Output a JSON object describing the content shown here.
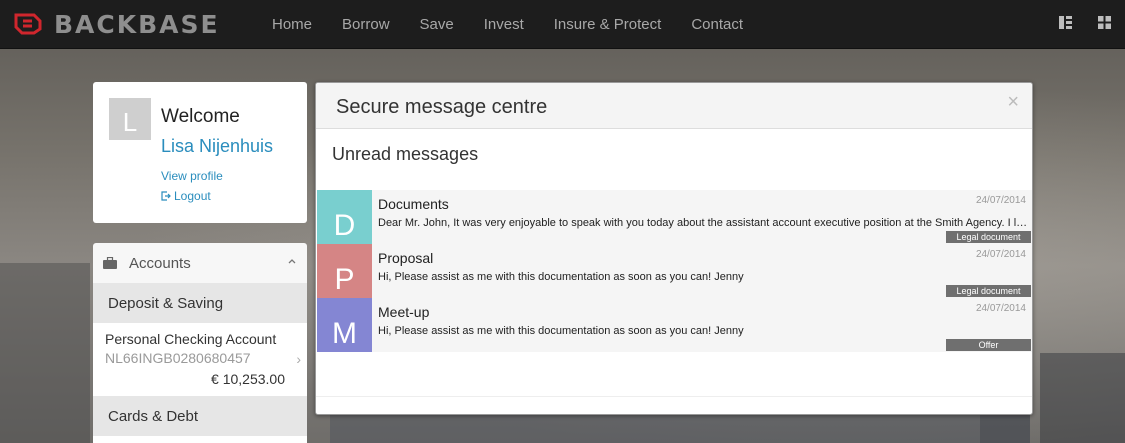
{
  "nav": {
    "brand": "BACKBASE",
    "links": [
      "Home",
      "Borrow",
      "Save",
      "Invest",
      "Insure & Protect",
      "Contact"
    ],
    "icons": [
      "layout-icon",
      "grid-icon"
    ]
  },
  "welcome": {
    "avatar_initial": "L",
    "greeting": "Welcome",
    "name": "Lisa Nijenhuis",
    "view_profile": "View profile",
    "logout": "Logout"
  },
  "accounts": {
    "title": "Accounts",
    "sections": [
      {
        "title": "Deposit & Saving",
        "items": [
          {
            "name": "Personal Checking Account",
            "iban": "NL66INGB0280680457",
            "balance": "€ 10,253.00"
          }
        ]
      },
      {
        "title": "Cards & Debt"
      }
    ]
  },
  "messages": {
    "title": "Secure message centre",
    "close": "×",
    "unread_title": "Unread messages",
    "items": [
      {
        "letter": "D",
        "color": "#79cfcf",
        "subject": "Documents",
        "date": "24/07/2014",
        "body": "Dear Mr. John, It was very enjoyable to speak with you today about the assistant account executive position at the Smith Agency. I look forward",
        "tag": "Legal document"
      },
      {
        "letter": "P",
        "color": "#d58585",
        "subject": "Proposal",
        "date": "24/07/2014",
        "body": "Hi, Please assist as me with this documentation as soon as you can! Jenny",
        "tag": "Legal document"
      },
      {
        "letter": "M",
        "color": "#8486d3",
        "subject": "Meet-up",
        "date": "24/07/2014",
        "body": "Hi, Please assist as me with this documentation as soon as you can! Jenny",
        "tag": "Offer"
      }
    ]
  },
  "colors": {
    "nav_bg": "#1d1d1d",
    "brand_red": "#d0262d",
    "link_blue": "#2a8dbd"
  }
}
